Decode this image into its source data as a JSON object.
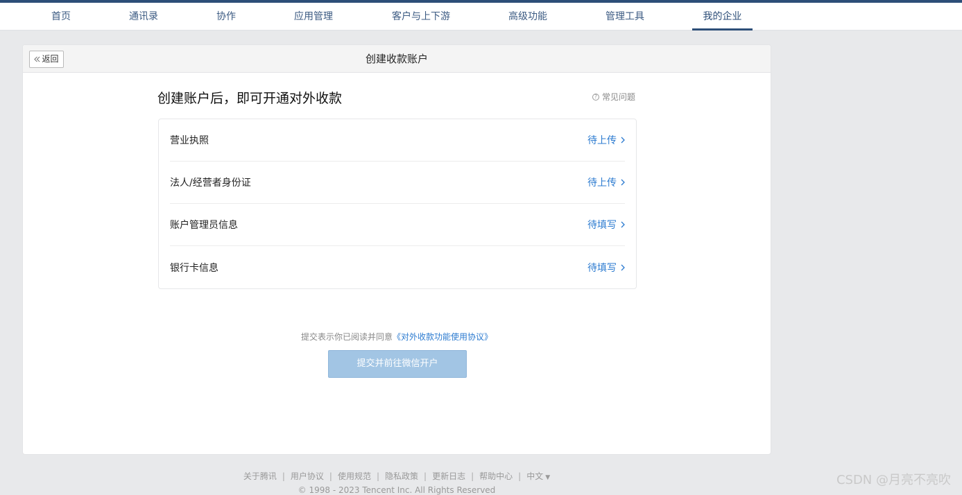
{
  "nav": {
    "items": [
      {
        "label": "首页"
      },
      {
        "label": "通讯录"
      },
      {
        "label": "协作"
      },
      {
        "label": "应用管理"
      },
      {
        "label": "客户与上下游"
      },
      {
        "label": "高级功能"
      },
      {
        "label": "管理工具"
      },
      {
        "label": "我的企业"
      }
    ],
    "active_label": "我的企业",
    "accent_color": "#2d4e78"
  },
  "header": {
    "back_label": "返回",
    "title": "创建收款账户"
  },
  "main": {
    "headline": "创建账户后，即可开通对外收款",
    "faq_label": "常见问题",
    "items": [
      {
        "label": "营业执照",
        "status": "待上传"
      },
      {
        "label": "法人/经营者身份证",
        "status": "待上传"
      },
      {
        "label": "账户管理员信息",
        "status": "待填写"
      },
      {
        "label": "银行卡信息",
        "status": "待填写"
      }
    ],
    "agreement_prefix": "提交表示你已阅读并同意",
    "agreement_link": "《对外收款功能使用协议》",
    "submit_label": "提交并前往微信开户",
    "link_color": "#2c7bd0"
  },
  "footer": {
    "links": [
      "关于腾讯",
      "用户协议",
      "使用规范",
      "隐私政策",
      "更新日志",
      "帮助中心"
    ],
    "language": "中文",
    "copyright": "© 1998 - 2023 Tencent Inc. All Rights Reserved"
  },
  "watermark": "CSDN @月亮不亮吹"
}
